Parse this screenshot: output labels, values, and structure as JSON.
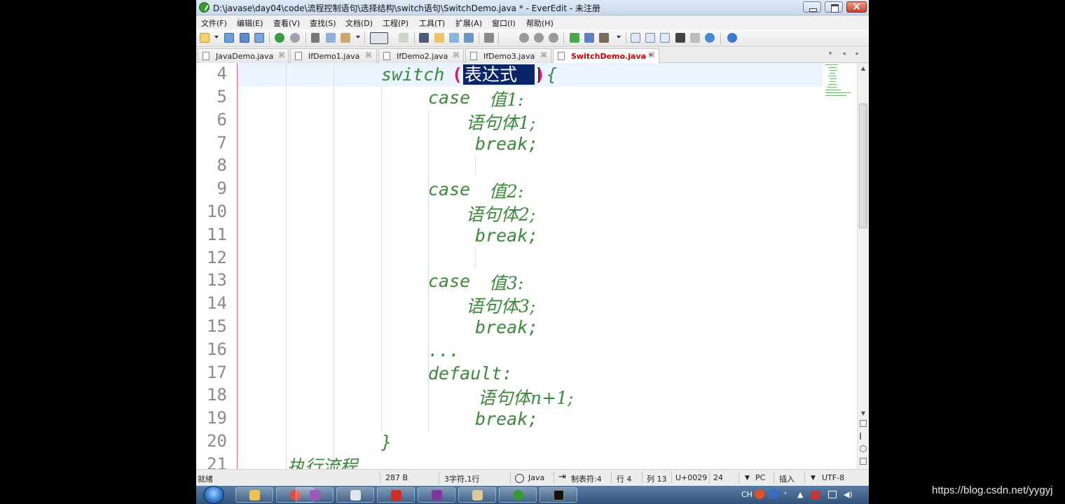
{
  "window": {
    "title": "D:\\javase\\day04\\code\\流程控制语句\\选择结构\\switch语句\\SwitchDemo.java * - EverEdit - 未注册"
  },
  "menu": [
    "文件(F)",
    "编辑(E)",
    "查看(V)",
    "查找(S)",
    "文档(D)",
    "工程(P)",
    "工具(T)",
    "扩展(A)",
    "窗口(I)",
    "帮助(H)"
  ],
  "tabs": [
    {
      "label": "JavaDemo.java",
      "close": "⌘",
      "active": false
    },
    {
      "label": "IfDemo1.java",
      "close": "⌘",
      "active": false
    },
    {
      "label": "IfDemo2.java",
      "close": "⌘",
      "active": false
    },
    {
      "label": "IfDemo3.java",
      "close": "⌘",
      "active": false
    },
    {
      "label": "SwitchDemo.java *",
      "close": "⌘",
      "active": true
    }
  ],
  "tab_nav": "▾ ◂ ▸",
  "editor": {
    "line_numbers": [
      "4",
      "5",
      "6",
      "7",
      "8",
      "9",
      "10",
      "11",
      "12",
      "13",
      "14",
      "15",
      "16",
      "17",
      "18",
      "19",
      "20",
      "21"
    ],
    "line4": {
      "keyword": "switch",
      "open": "(",
      "selection": "表达式",
      "close": ")",
      "brace": "{"
    },
    "lines": [
      {
        "l": "case ",
        "r": "值1:"
      },
      {
        "l": "",
        "r": "语句体1;"
      },
      {
        "l": "break;",
        "r": ""
      },
      {
        "l": "case ",
        "r": "值2:"
      },
      {
        "l": "",
        "r": "语句体2;"
      },
      {
        "l": "break;",
        "r": ""
      },
      {
        "l": "case ",
        "r": "值3:"
      },
      {
        "l": "",
        "r": "语句体3;"
      },
      {
        "l": "break;",
        "r": ""
      },
      {
        "l": "...",
        "r": ""
      },
      {
        "l": "default:",
        "r": ""
      },
      {
        "l": "",
        "r": "语句体n+1;"
      },
      {
        "l": "break;",
        "r": ""
      },
      {
        "l": "}",
        "r": ""
      },
      {
        "l": "",
        "r": "执行流程"
      }
    ]
  },
  "status": {
    "ready": "就绪",
    "size": "287 B",
    "selection": "3字符,1行",
    "language": "Java",
    "tab": "制表符:4",
    "row": "行 4",
    "col": "列 13",
    "unicode": "U+0029",
    "num": "24",
    "eol": "PC",
    "mode": "插入",
    "encoding": "UTF-8"
  },
  "taskbar": {
    "tray_text": "CH",
    "tray_icons": [
      "sogou-icon",
      "help-icon",
      "arrow-icon",
      "flag-icon",
      "monitor-icon",
      "speaker-icon"
    ]
  },
  "watermark": "https://blog.csdn.net/yygyj",
  "colors": {
    "code": "#3a8a3a",
    "selection": "#0a246a",
    "paren": "#e0116a",
    "line_number": "#8a8a8a"
  }
}
